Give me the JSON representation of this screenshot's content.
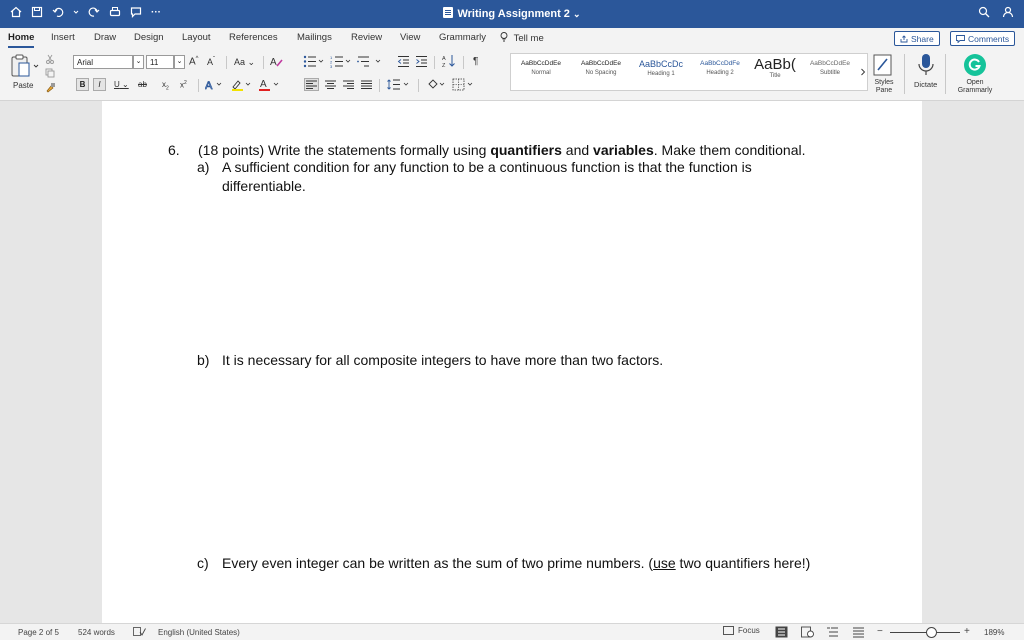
{
  "window": {
    "title": "Writing Assignment 2",
    "title_chevron": "⌄",
    "more_label": "···"
  },
  "tabs": {
    "items": [
      "Home",
      "Insert",
      "Draw",
      "Design",
      "Layout",
      "References",
      "Mailings",
      "Review",
      "View",
      "Grammarly"
    ],
    "active": "Home",
    "tell_me": "Tell me",
    "share_label": "Share",
    "comments_label": "Comments"
  },
  "ribbon": {
    "paste_label": "Paste",
    "font_name": "Arial",
    "font_size": "11",
    "grow_font": "A",
    "shrink_font": "A",
    "change_case": "Aa",
    "bold": "B",
    "italic": "I",
    "underline": "U",
    "strike": "ab",
    "subscript": "x",
    "superscript": "x",
    "para_mark": "¶",
    "styles": [
      {
        "sample": "AaBbCcDdEe",
        "name": "Normal"
      },
      {
        "sample": "AaBbCcDdEe",
        "name": "No Spacing"
      },
      {
        "sample": "AaBbCcDc",
        "name": "Heading 1"
      },
      {
        "sample": "AaBbCcDdFe",
        "name": "Heading 2"
      },
      {
        "sample": "AaBb(",
        "name": "Title"
      },
      {
        "sample": "AaBbCcDdEe",
        "name": "Subtitle"
      }
    ],
    "styles_pane_label": "Styles Pane",
    "dictate_label": "Dictate",
    "grammarly_label": "Open Grammarly"
  },
  "document": {
    "question_number": "6.",
    "question_prefix": "(18 points) Write the statements formally using ",
    "question_bold1": "quantifiers",
    "question_mid": " and ",
    "question_bold2": "variables",
    "question_suffix": ". Make them conditional.",
    "part_a_label": "a)",
    "part_a_line1": "A sufficient condition for any function to be a continuous function is that the function is",
    "part_a_line2": "differentiable.",
    "part_b_label": "b)",
    "part_b_text": "It is necessary for all composite integers to have more than two factors.",
    "part_c_label": "c)",
    "part_c_prefix": "Every even integer can be written as the sum of two prime numbers. (",
    "part_c_underlined": "use",
    "part_c_suffix": " two quantifiers here!)"
  },
  "status": {
    "page": "Page 2 of 5",
    "words": "524 words",
    "language": "English (United States)",
    "focus": "Focus",
    "zoom": "189%",
    "zoom_minus": "−",
    "zoom_plus": "+"
  },
  "colors": {
    "titlebar": "#2b579a",
    "accent": "#2b579a",
    "grammarly": "#15c39a"
  }
}
